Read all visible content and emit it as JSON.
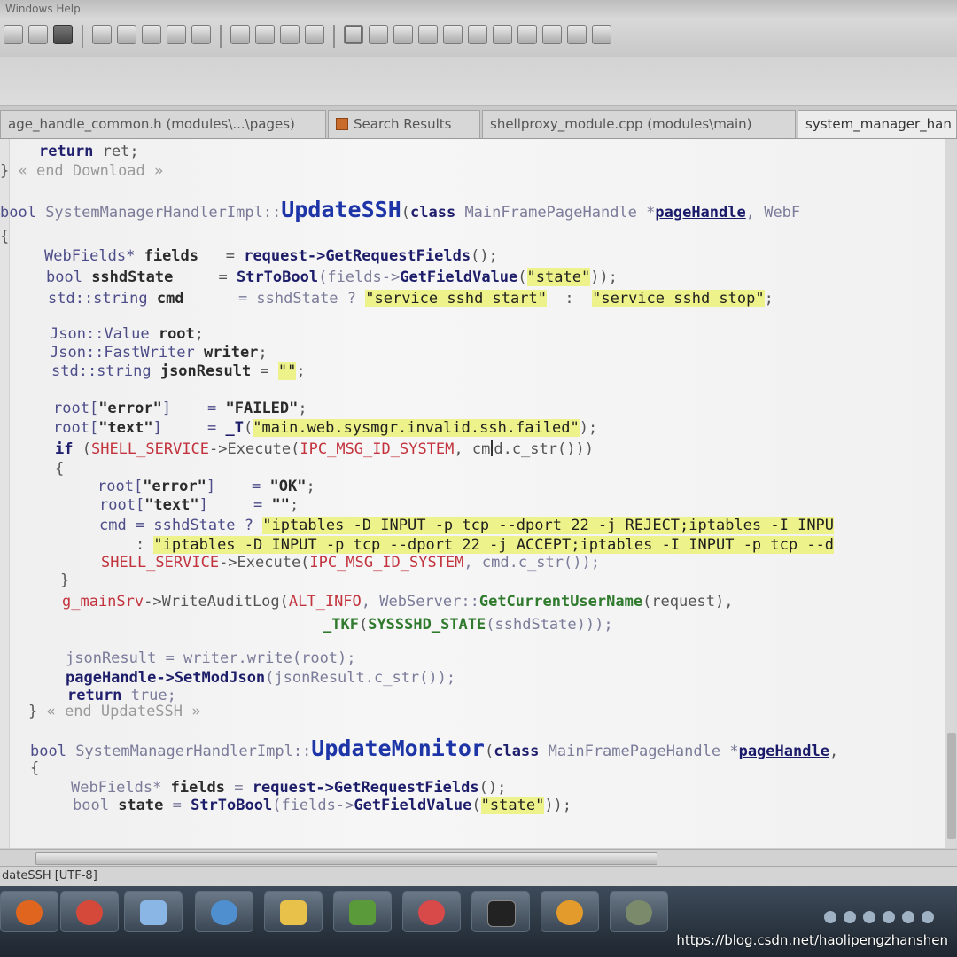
{
  "window": {
    "title": "Windows Help"
  },
  "tabs": [
    {
      "label": "age_handle_common.h (modules\\...\\pages)"
    },
    {
      "label": "Search Results"
    },
    {
      "label": "shellproxy_module.cpp (modules\\main)"
    },
    {
      "label": "system_manager_han"
    }
  ],
  "code": {
    "l1_kw": "return",
    "l1_rest": " ret;",
    "l2_brace": "}",
    "l2_comment": " « end Download »",
    "l3_type": "bool ",
    "l3_class": "SystemManagerHandlerImpl::",
    "l3_fn": "UpdateSSH",
    "l3_p1": "(",
    "l3_kw": "class",
    "l3_ptype": " MainFramePageHandle *",
    "l3_param": "pageHandle",
    "l3_rest": ", WebF",
    "l4": "{",
    "l5_type": "WebFields* ",
    "l5_id": "fields",
    "l5_eq": "   = ",
    "l5_fn": "request->GetRequestFields",
    "l5_end": "();",
    "l6_type": "bool ",
    "l6_id": "sshdState",
    "l6_eq": "     = ",
    "l6_fn": "StrToBool",
    "l6_mid": "(fields->",
    "l6_fn2": "GetFieldValue",
    "l6_p": "(",
    "l6_str": "\"state\"",
    "l6_end": "));",
    "l7_type": "std::string ",
    "l7_id": "cmd",
    "l7_eq": "      = sshdState ? ",
    "l7_s1": "\"service sshd start\"",
    "l7_colon": "  :  ",
    "l7_s2": "\"service sshd stop\"",
    "l7_end": ";",
    "l8_type": "Json::Value ",
    "l8_id": "root",
    "l8_end": ";",
    "l9_type": "Json::FastWriter ",
    "l9_id": "writer",
    "l9_end": ";",
    "l10_type": "std::string ",
    "l10_id": "jsonResult",
    "l10_eq": " = ",
    "l10_str": "\"\"",
    "l10_end": ";",
    "l11_a": "root[",
    "l11_s": "\"error\"",
    "l11_b": "]    = ",
    "l11_v": "\"FAILED\"",
    "l11_end": ";",
    "l12_a": "root[",
    "l12_s": "\"text\"",
    "l12_b": "]     = ",
    "l12_fn": "_T",
    "l12_p": "(",
    "l12_v": "\"main.web.sysmgr.invalid.ssh.failed\"",
    "l12_end": ");",
    "l13_kw": "if",
    "l13_p": " (",
    "l13_mac": "SHELL_SERVICE",
    "l13_arrow": "->Execute(",
    "l13_mac2": "IPC_MSG_ID_SYSTEM",
    "l13_mid": ", cm",
    "l13_after": "d.c_str()))",
    "l14": "{",
    "l15_a": "root[",
    "l15_s": "\"error\"",
    "l15_b": "]    = ",
    "l15_v": "\"OK\"",
    "l15_end": ";",
    "l16_a": "root[",
    "l16_s": "\"text\"",
    "l16_b": "]     = ",
    "l16_v": "\"\"",
    "l16_end": ";",
    "l17_a": "cmd = sshdState ? ",
    "l17_s": "\"iptables -D INPUT -p tcp --dport 22 -j REJECT;iptables -I INPU",
    "l18_a": "    : ",
    "l18_s": "\"iptables -D INPUT -p tcp --dport 22 -j ACCEPT;iptables -I INPUT -p tcp --d",
    "l19_mac": "SHELL_SERVICE",
    "l19_arrow": "->Execute(",
    "l19_mac2": "IPC_MSG_ID_SYSTEM",
    "l19_end": ", cmd.c_str());",
    "l20": "}",
    "l21_g": "g_mainSrv",
    "l21_a": "->WriteAuditLog(",
    "l21_mac": "ALT_INFO",
    "l21_b": ", WebServer::",
    "l21_fn": "GetCurrentUserName",
    "l21_c": "(request),",
    "l22_fn": "_TKF",
    "l22_p": "(",
    "l22_mac": "SYSSSHD_STATE",
    "l22_end": "(sshdState)));",
    "l23": "jsonResult = writer.write(root);",
    "l24_fn": "pageHandle->SetModJson",
    "l24_end": "(jsonResult.c_str());",
    "l25_kw": "return",
    "l25_end": " true;",
    "l26_brace": "}",
    "l26_comment": " « end UpdateSSH »",
    "l27_type": "bool ",
    "l27_class": "SystemManagerHandlerImpl::",
    "l27_fn": "UpdateMonitor",
    "l27_p1": "(",
    "l27_kw": "class",
    "l27_ptype": " MainFramePageHandle *",
    "l27_param": "pageHandle",
    "l27_rest": ",",
    "l28": "{",
    "l29_type": "WebFields* ",
    "l29_id": "fields",
    "l29_eq": " = ",
    "l29_fn": "request->GetRequestFields",
    "l29_end": "();",
    "l30_type": "bool ",
    "l30_id": "state",
    "l30_eq": " = ",
    "l30_fn": "StrToBool",
    "l30_mid": "(fields->",
    "l30_fn2": "GetFieldValue",
    "l30_p": "(",
    "l30_str": "\"state\"",
    "l30_end": "));"
  },
  "status": {
    "text": "dateSSH [UTF-8]"
  },
  "taskbar": {
    "apps": [
      {
        "icon": "firefox-icon",
        "color": "#e0661f"
      },
      {
        "icon": "chrome-icon",
        "color": "#d5493a"
      },
      {
        "icon": "notepad-icon",
        "color": "#8ab6e6"
      },
      {
        "icon": "browser-icon",
        "color": "#4f8fd0"
      },
      {
        "icon": "explorer-icon",
        "color": "#e8c14a"
      },
      {
        "icon": "chart-app-icon",
        "color": "#5a9a3a"
      },
      {
        "icon": "bird-app-icon",
        "color": "#d84a4a"
      },
      {
        "icon": "terminal-icon",
        "color": "#222222"
      },
      {
        "icon": "search-app-icon",
        "color": "#e39b2b"
      },
      {
        "icon": "turtle-app-icon",
        "color": "#7a8a6a"
      }
    ]
  },
  "watermark": "https://blog.csdn.net/haolipengzhanshen"
}
